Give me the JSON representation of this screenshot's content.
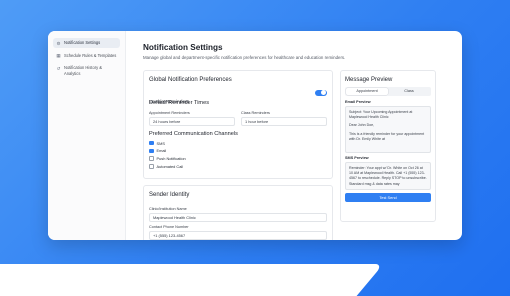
{
  "sidebar": {
    "items": [
      {
        "label": "Notification Settings",
        "icon": "gear-icon"
      },
      {
        "label": "Schedule Rules & Templates",
        "icon": "calendar-icon"
      },
      {
        "label": "Notification History & Analytics",
        "icon": "history-icon"
      }
    ]
  },
  "header": {
    "title": "Notification Settings",
    "subtitle": "Manage global and department-specific notification preferences for healthcare and education reminders."
  },
  "global": {
    "title": "Global Notification Preferences",
    "enable_label": "Enable Reminders",
    "enable_on": true,
    "default_times_title": "Default Reminder Times",
    "appointment_label": "Appointment Reminders",
    "appointment_value": "24 hours before",
    "class_label": "Class Reminders",
    "class_value": "1 hour before",
    "channels_title": "Preferred Communication Channels",
    "channels": [
      {
        "label": "SMS",
        "checked": true
      },
      {
        "label": "Email",
        "checked": true
      },
      {
        "label": "Push Notification",
        "checked": false
      },
      {
        "label": "Automated Call",
        "checked": false
      }
    ]
  },
  "sender": {
    "title": "Sender Identity",
    "clinic_label": "Clinic/Institution Name",
    "clinic_value": "Maplewood Health Clinic",
    "phone_label": "Contact Phone Number",
    "phone_value": "+1 (555) 123-4567"
  },
  "preview": {
    "title": "Message Preview",
    "tabs": [
      "Appointment",
      "Class"
    ],
    "active_tab": 0,
    "email_label": "Email Preview",
    "email_subject": "Subject: Your Upcoming Appointment at Maplewood Health Clinic",
    "email_greeting": "Dear John Doe,",
    "email_body": "This is a friendly reminder for your appointment with Dr. Emily White at",
    "sms_label": "SMS Preview",
    "sms_body": "Reminder: Your appt w/ Dr. White on Oct 26 at 10 AM at Maplewood Health. Call +1 (555) 123-4567 to reschedule. Reply STOP to unsubscribe. Standard msg & data rates may",
    "button_label": "Test Send"
  }
}
